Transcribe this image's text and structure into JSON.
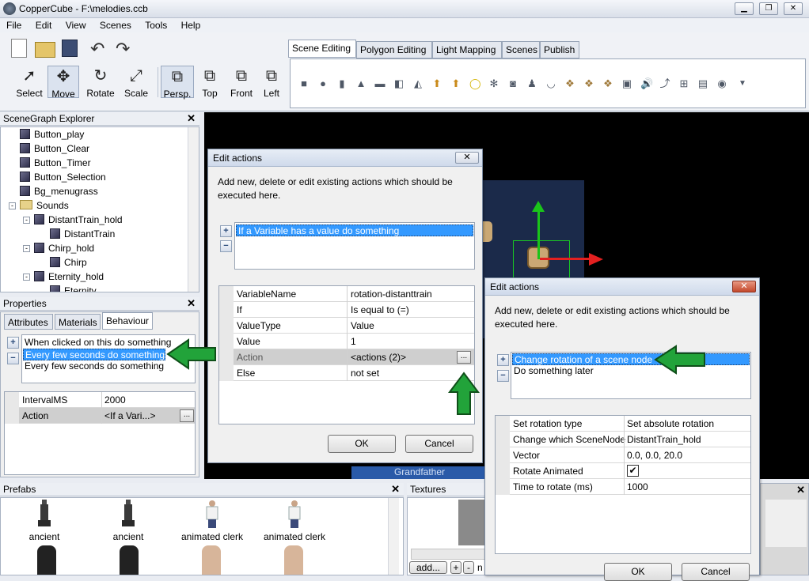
{
  "window": {
    "title": "CopperCube - F:\\melodies.ccb",
    "minimize": "▁",
    "restore": "❐",
    "close": "✕"
  },
  "menu": [
    "File",
    "Edit",
    "View",
    "Scenes",
    "Tools",
    "Help"
  ],
  "toolbar": {
    "tools": [
      {
        "label": "Select",
        "icon": "cursor-icon"
      },
      {
        "label": "Move",
        "icon": "move-icon"
      },
      {
        "label": "Rotate",
        "icon": "rotate-icon"
      },
      {
        "label": "Scale",
        "icon": "scale-icon"
      }
    ],
    "views": [
      {
        "label": "Persp."
      },
      {
        "label": "Top"
      },
      {
        "label": "Front"
      },
      {
        "label": "Left"
      }
    ]
  },
  "tabs": [
    "Scene Editing",
    "Polygon Editing",
    "Light Mapping",
    "Scenes",
    "Publish"
  ],
  "scenegraph": {
    "title": "SceneGraph Explorer",
    "items": [
      {
        "label": "Button_play",
        "kind": "node"
      },
      {
        "label": "Button_Clear",
        "kind": "node"
      },
      {
        "label": "Button_Timer",
        "kind": "node"
      },
      {
        "label": "Button_Selection",
        "kind": "node"
      },
      {
        "label": "Bg_menugrass",
        "kind": "node"
      },
      {
        "label": "Sounds",
        "kind": "folder"
      },
      {
        "label": "DistantTrain_hold",
        "kind": "node"
      },
      {
        "label": "DistantTrain",
        "kind": "node"
      },
      {
        "label": "Chirp_hold",
        "kind": "node"
      },
      {
        "label": "Chirp",
        "kind": "node"
      },
      {
        "label": "Eternity_hold",
        "kind": "node"
      },
      {
        "label": "Eternity",
        "kind": "node"
      }
    ]
  },
  "properties": {
    "title": "Properties",
    "tabs": [
      "Attributes",
      "Materials",
      "Behaviour"
    ],
    "behaviours": [
      "When clicked on this do something",
      "Every few seconds do something",
      "Every few seconds do something"
    ],
    "grid": [
      {
        "key": "IntervalMS",
        "value": "2000"
      },
      {
        "key": "Action",
        "value": "<If a Vari...>"
      }
    ],
    "ellipsis": "..."
  },
  "viewport": {
    "label": "Grandfather"
  },
  "dialog1": {
    "title": "Edit actions",
    "description": "Add new, delete or edit existing actions which should be executed here.",
    "actions": [
      "If a Variable has a value do something"
    ],
    "grid": [
      {
        "key": "VariableName",
        "value": "rotation-distanttrain"
      },
      {
        "key": "If",
        "value": "Is equal to (=)"
      },
      {
        "key": "ValueType",
        "value": "Value"
      },
      {
        "key": "Value",
        "value": "1"
      },
      {
        "key": "Action",
        "value": "<actions (2)>"
      },
      {
        "key": "Else",
        "value": "not set"
      }
    ],
    "ok": "OK",
    "cancel": "Cancel",
    "ellipsis": "..."
  },
  "dialog2": {
    "title": "Edit actions",
    "description": "Add new, delete or edit existing actions which should be executed here.",
    "actions": [
      "Change rotation of a scene node",
      "Do something later"
    ],
    "grid": [
      {
        "key": "Set rotation type",
        "value": "Set absolute rotation"
      },
      {
        "key": "Change which SceneNode",
        "value": "DistantTrain_hold"
      },
      {
        "key": "Vector",
        "value": "0.0, 0.0, 20.0"
      },
      {
        "key": "Rotate Animated",
        "value": "✔"
      },
      {
        "key": "Time to rotate (ms)",
        "value": "1000"
      }
    ],
    "ok": "OK",
    "cancel": "Cancel"
  },
  "prefabs": {
    "title": "Prefabs",
    "items": [
      "ancient",
      "ancient",
      "animated clerk",
      "animated clerk"
    ]
  },
  "textures": {
    "title": "Textures",
    "add_label": "add...",
    "plus": "+",
    "minus": "-",
    "tail": "n"
  },
  "colors": {
    "accent_green": "#22a33a",
    "selection": "#3399ff"
  }
}
